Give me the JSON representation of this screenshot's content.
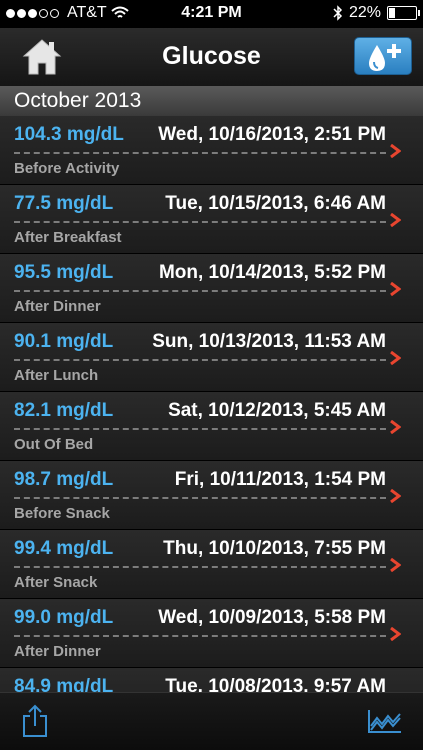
{
  "status": {
    "carrier": "AT&T",
    "time": "4:21 PM",
    "battery": "22%",
    "battery_level": 0.22,
    "signal_strength": 3
  },
  "nav": {
    "title": "Glucose",
    "home_icon": "home-icon",
    "add_icon": "add-glucose-reading-icon"
  },
  "section": {
    "header": "October 2013"
  },
  "readings": [
    {
      "value": "104.3 mg/dL",
      "date": "Wed, 10/16/2013, 2:51 PM",
      "context": "Before Activity"
    },
    {
      "value": "77.5 mg/dL",
      "date": "Tue, 10/15/2013, 6:46 AM",
      "context": "After Breakfast"
    },
    {
      "value": "95.5 mg/dL",
      "date": "Mon, 10/14/2013, 5:52 PM",
      "context": "After Dinner"
    },
    {
      "value": "90.1 mg/dL",
      "date": "Sun, 10/13/2013, 11:53 AM",
      "context": "After Lunch"
    },
    {
      "value": "82.1 mg/dL",
      "date": "Sat, 10/12/2013, 5:45 AM",
      "context": "Out Of Bed"
    },
    {
      "value": "98.7 mg/dL",
      "date": "Fri, 10/11/2013, 1:54 PM",
      "context": "Before Snack"
    },
    {
      "value": "99.4 mg/dL",
      "date": "Thu, 10/10/2013, 7:55 PM",
      "context": "After Snack"
    },
    {
      "value": "99.0 mg/dL",
      "date": "Wed, 10/09/2013, 5:58 PM",
      "context": "After Dinner"
    },
    {
      "value": "84.9 mg/dL",
      "date": "Tue, 10/08/2013, 9:57 AM",
      "context": ""
    }
  ],
  "colors": {
    "value_text": "#4cb3f0",
    "chevron": "#e8452f",
    "accent_blue": "#3a8fd0"
  },
  "tabbar": {
    "share_icon": "share-icon",
    "chart_icon": "line-chart-icon"
  }
}
